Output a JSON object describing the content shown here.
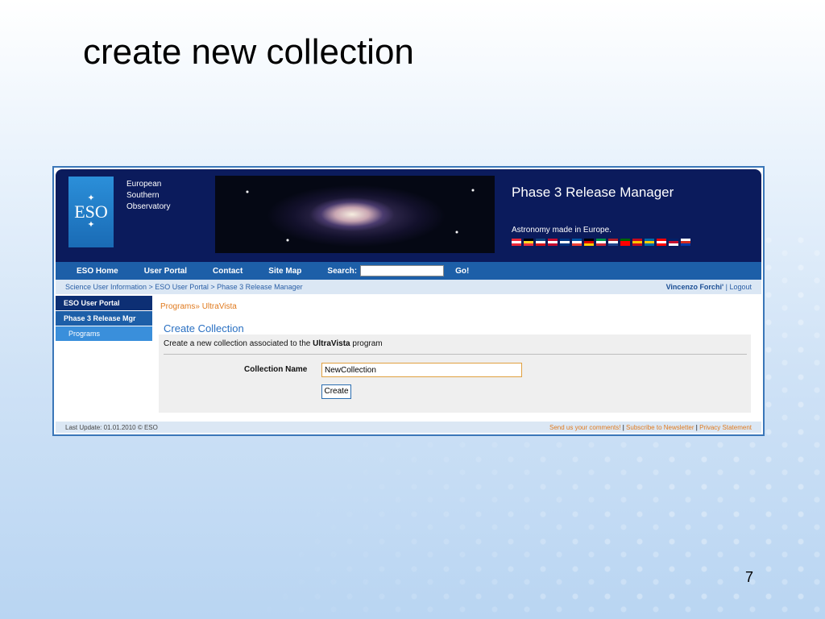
{
  "slide": {
    "title": "create new collection",
    "page_number": "7"
  },
  "header": {
    "org_name_lines": [
      "European",
      "Southern",
      "Observatory"
    ],
    "logo_text": "ESO",
    "app_title": "Phase 3 Release Manager",
    "tagline": "Astronomy made in Europe.",
    "flag_colors": [
      [
        "#ed2939",
        "#fff",
        "#ed2939"
      ],
      [
        "#000",
        "#fdda24",
        "#ef3340"
      ],
      [
        "#11457e",
        "#fff",
        "#d7141a"
      ],
      [
        "#c60c30",
        "#fff",
        "#c60c30"
      ],
      [
        "#003580",
        "#fff",
        "#003580"
      ],
      [
        "#0055a4",
        "#fff",
        "#ef4135"
      ],
      [
        "#000",
        "#dd0000",
        "#ffce00"
      ],
      [
        "#009246",
        "#fff",
        "#ce2b37"
      ],
      [
        "#ae1c28",
        "#fff",
        "#21468b"
      ],
      [
        "#006600",
        "#ff0000",
        "#ff0000"
      ],
      [
        "#c60b1e",
        "#ffc400",
        "#c60b1e"
      ],
      [
        "#006aa7",
        "#fecc00",
        "#006aa7"
      ],
      [
        "#ff0000",
        "#fff",
        "#ff0000"
      ],
      [
        "#012169",
        "#c8102e",
        "#fff"
      ],
      [
        "#fff",
        "#d52b1e",
        "#0039a6"
      ]
    ]
  },
  "nav": {
    "links": [
      "ESO Home",
      "User Portal",
      "Contact",
      "Site Map"
    ],
    "search_label": "Search:",
    "go_label": "Go!"
  },
  "breadcrumb": {
    "path": "Science User Information > ESO User Portal > Phase 3 Release Manager",
    "user": "Vincenzo Forchi'",
    "logout": "Logout"
  },
  "sidebar": {
    "items": [
      {
        "label": "ESO User Portal"
      },
      {
        "label": "Phase 3 Release Mgr"
      },
      {
        "label": "Programs"
      }
    ]
  },
  "main": {
    "crumb_programs": "Programs",
    "crumb_sep": "»",
    "crumb_current": "UltraVista",
    "panel_title": "Create Collection",
    "desc_prefix": "Create a new collection associated to the ",
    "desc_program": "UltraVista",
    "desc_suffix": " program",
    "field_label": "Collection Name",
    "field_value": "NewCollection",
    "create_label": "Create"
  },
  "footer": {
    "last_update": "Last Update: 01.01.2010 © ESO",
    "links": [
      "Send us your comments!",
      "Subscribe to Newsletter",
      "Privacy Statement"
    ]
  }
}
